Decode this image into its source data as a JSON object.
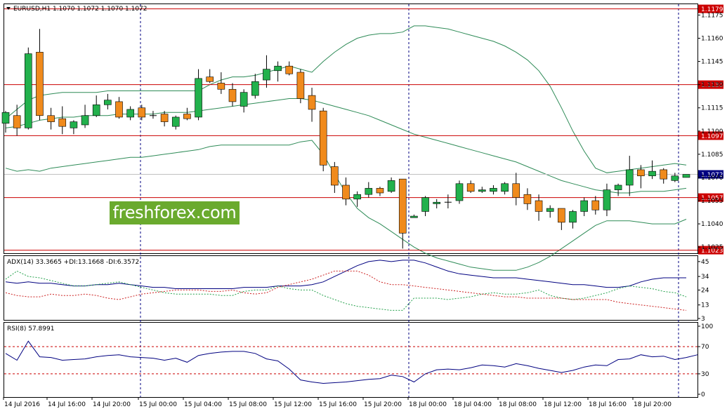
{
  "chart_data": {
    "type": "candlestick",
    "symbol_header": "EURUSD,H1  1.1070 1.1072 1.1070 1.1072",
    "x_labels": [
      "14 Jul 2016",
      "14 Jul 16:00",
      "14 Jul 20:00",
      "15 Jul 00:00",
      "15 Jul 04:00",
      "15 Jul 08:00",
      "15 Jul 12:00",
      "15 Jul 16:00",
      "15 Jul 20:00",
      "18 Jul 00:00",
      "18 Jul 04:00",
      "18 Jul 08:00",
      "18 Jul 12:00",
      "18 Jul 16:00",
      "18 Jul 20:00"
    ],
    "price_axis": {
      "ylim": [
        1.1021,
        1.1182
      ],
      "ticks": [
        "1.1175",
        "1.1160",
        "1.1145",
        "1.1130",
        "1.1115",
        "1.1100",
        "1.1085",
        "1.1070",
        "1.1055",
        "1.1040",
        "1.1025"
      ],
      "tick_values": [
        1.1175,
        1.116,
        1.1145,
        1.113,
        1.1115,
        1.11,
        1.1085,
        1.107,
        1.1055,
        1.104,
        1.1025
      ]
    },
    "candles": [
      {
        "o": 1.1105,
        "h": 1.1113,
        "l": 1.1099,
        "c": 1.1112
      },
      {
        "o": 1.111,
        "h": 1.1117,
        "l": 1.1097,
        "c": 1.1102
      },
      {
        "o": 1.1102,
        "h": 1.1154,
        "l": 1.1101,
        "c": 1.115
      },
      {
        "o": 1.1151,
        "h": 1.1166,
        "l": 1.1107,
        "c": 1.111
      },
      {
        "o": 1.111,
        "h": 1.1115,
        "l": 1.1101,
        "c": 1.1106
      },
      {
        "o": 1.1108,
        "h": 1.1116,
        "l": 1.1098,
        "c": 1.1103
      },
      {
        "o": 1.1102,
        "h": 1.1107,
        "l": 1.1098,
        "c": 1.1106
      },
      {
        "o": 1.1104,
        "h": 1.1117,
        "l": 1.1102,
        "c": 1.111
      },
      {
        "o": 1.111,
        "h": 1.1123,
        "l": 1.1109,
        "c": 1.1117
      },
      {
        "o": 1.1117,
        "h": 1.1124,
        "l": 1.1114,
        "c": 1.112
      },
      {
        "o": 1.1119,
        "h": 1.1122,
        "l": 1.1108,
        "c": 1.1109
      },
      {
        "o": 1.1109,
        "h": 1.1116,
        "l": 1.1107,
        "c": 1.1114
      },
      {
        "o": 1.1115,
        "h": 1.1117,
        "l": 1.1107,
        "c": 1.1109
      },
      {
        "o": 1.111,
        "h": 1.1113,
        "l": 1.1108,
        "c": 1.111
      },
      {
        "o": 1.1111,
        "h": 1.1113,
        "l": 1.1103,
        "c": 1.1106
      },
      {
        "o": 1.1103,
        "h": 1.111,
        "l": 1.1101,
        "c": 1.1109
      },
      {
        "o": 1.1111,
        "h": 1.1115,
        "l": 1.1107,
        "c": 1.1108
      },
      {
        "o": 1.1109,
        "h": 1.114,
        "l": 1.1107,
        "c": 1.1134
      },
      {
        "o": 1.1135,
        "h": 1.114,
        "l": 1.1131,
        "c": 1.1132
      },
      {
        "o": 1.1131,
        "h": 1.1138,
        "l": 1.1124,
        "c": 1.1127
      },
      {
        "o": 1.1127,
        "h": 1.1131,
        "l": 1.1116,
        "c": 1.1119
      },
      {
        "o": 1.1116,
        "h": 1.1127,
        "l": 1.1112,
        "c": 1.1125
      },
      {
        "o": 1.1123,
        "h": 1.1137,
        "l": 1.1121,
        "c": 1.1132
      },
      {
        "o": 1.1133,
        "h": 1.1149,
        "l": 1.1128,
        "c": 1.114
      },
      {
        "o": 1.1139,
        "h": 1.1145,
        "l": 1.1132,
        "c": 1.1142
      },
      {
        "o": 1.1142,
        "h": 1.1145,
        "l": 1.1136,
        "c": 1.1137
      },
      {
        "o": 1.1138,
        "h": 1.114,
        "l": 1.1118,
        "c": 1.1121
      },
      {
        "o": 1.1123,
        "h": 1.1128,
        "l": 1.1106,
        "c": 1.1114
      },
      {
        "o": 1.1113,
        "h": 1.1115,
        "l": 1.1074,
        "c": 1.1078
      },
      {
        "o": 1.1077,
        "h": 1.108,
        "l": 1.106,
        "c": 1.1065
      },
      {
        "o": 1.1065,
        "h": 1.107,
        "l": 1.1052,
        "c": 1.1056
      },
      {
        "o": 1.1056,
        "h": 1.1061,
        "l": 1.1051,
        "c": 1.1059
      },
      {
        "o": 1.1059,
        "h": 1.1067,
        "l": 1.1057,
        "c": 1.1063
      },
      {
        "o": 1.1063,
        "h": 1.1064,
        "l": 1.1058,
        "c": 1.106
      },
      {
        "o": 1.1061,
        "h": 1.107,
        "l": 1.106,
        "c": 1.1068
      },
      {
        "o": 1.1069,
        "h": 1.1069,
        "l": 1.1024,
        "c": 1.1034
      },
      {
        "o": 1.1044,
        "h": 1.1046,
        "l": 1.1044,
        "c": 1.1045
      },
      {
        "o": 1.1048,
        "h": 1.1058,
        "l": 1.1045,
        "c": 1.1057
      },
      {
        "o": 1.1053,
        "h": 1.1056,
        "l": 1.105,
        "c": 1.1054
      },
      {
        "o": 1.1054,
        "h": 1.1059,
        "l": 1.105,
        "c": 1.1054
      },
      {
        "o": 1.1055,
        "h": 1.1068,
        "l": 1.1053,
        "c": 1.1066
      },
      {
        "o": 1.1066,
        "h": 1.1068,
        "l": 1.106,
        "c": 1.1061
      },
      {
        "o": 1.1061,
        "h": 1.1064,
        "l": 1.106,
        "c": 1.1062
      },
      {
        "o": 1.1061,
        "h": 1.1065,
        "l": 1.1059,
        "c": 1.1063
      },
      {
        "o": 1.1061,
        "h": 1.1067,
        "l": 1.1059,
        "c": 1.1066
      },
      {
        "o": 1.1066,
        "h": 1.1073,
        "l": 1.1052,
        "c": 1.1057
      },
      {
        "o": 1.1059,
        "h": 1.1063,
        "l": 1.1049,
        "c": 1.1053
      },
      {
        "o": 1.1055,
        "h": 1.1059,
        "l": 1.1042,
        "c": 1.1048
      },
      {
        "o": 1.1048,
        "h": 1.1052,
        "l": 1.1044,
        "c": 1.105
      },
      {
        "o": 1.105,
        "h": 1.105,
        "l": 1.1036,
        "c": 1.1041
      },
      {
        "o": 1.1041,
        "h": 1.1049,
        "l": 1.1037,
        "c": 1.1048
      },
      {
        "o": 1.1048,
        "h": 1.1057,
        "l": 1.1045,
        "c": 1.1055
      },
      {
        "o": 1.1055,
        "h": 1.1058,
        "l": 1.1046,
        "c": 1.1049
      },
      {
        "o": 1.1049,
        "h": 1.1066,
        "l": 1.1045,
        "c": 1.1062
      },
      {
        "o": 1.1062,
        "h": 1.1066,
        "l": 1.1058,
        "c": 1.1065
      },
      {
        "o": 1.1065,
        "h": 1.1084,
        "l": 1.1058,
        "c": 1.1075
      },
      {
        "o": 1.1075,
        "h": 1.1078,
        "l": 1.1063,
        "c": 1.1071
      },
      {
        "o": 1.1071,
        "h": 1.1081,
        "l": 1.1069,
        "c": 1.1074
      },
      {
        "o": 1.1075,
        "h": 1.1076,
        "l": 1.1066,
        "c": 1.1069
      },
      {
        "o": 1.1068,
        "h": 1.1073,
        "l": 1.1067,
        "c": 1.1071
      },
      {
        "o": 1.107,
        "h": 1.1072,
        "l": 1.107,
        "c": 1.1072
      }
    ],
    "bollinger": {
      "upper": [
        1.1108,
        1.1114,
        1.112,
        1.1123,
        1.1124,
        1.1125,
        1.1125,
        1.1125,
        1.1125,
        1.1126,
        1.1126,
        1.1126,
        1.1126,
        1.1126,
        1.1126,
        1.1126,
        1.1126,
        1.1126,
        1.113,
        1.1133,
        1.1135,
        1.1135,
        1.1136,
        1.1138,
        1.114,
        1.1142,
        1.114,
        1.1138,
        1.1145,
        1.1151,
        1.1156,
        1.116,
        1.1162,
        1.1163,
        1.1163,
        1.1164,
        1.1168,
        1.1168,
        1.1167,
        1.1166,
        1.1164,
        1.1162,
        1.116,
        1.1158,
        1.1155,
        1.1151,
        1.1146,
        1.1139,
        1.1129,
        1.1115,
        1.11,
        1.1087,
        1.1076,
        1.1073,
        1.1074,
        1.1075,
        1.1076,
        1.1077,
        1.1078,
        1.1079,
        1.1078
      ],
      "middle": [
        1.1102,
        1.1103,
        1.1105,
        1.1107,
        1.1108,
        1.1109,
        1.1109,
        1.111,
        1.111,
        1.111,
        1.1111,
        1.1111,
        1.1111,
        1.1111,
        1.1112,
        1.1112,
        1.1112,
        1.1113,
        1.1114,
        1.1115,
        1.1116,
        1.1117,
        1.1118,
        1.1119,
        1.112,
        1.1121,
        1.1121,
        1.112,
        1.1118,
        1.1116,
        1.1114,
        1.1112,
        1.111,
        1.1107,
        1.1104,
        1.1101,
        1.1098,
        1.1096,
        1.1094,
        1.1092,
        1.109,
        1.1088,
        1.1086,
        1.1084,
        1.1082,
        1.108,
        1.1077,
        1.1074,
        1.1071,
        1.1068,
        1.1066,
        1.1064,
        1.1062,
        1.1061,
        1.106,
        1.106,
        1.1061,
        1.1061,
        1.1061,
        1.1062,
        1.1063
      ],
      "lower": [
        1.1076,
        1.1074,
        1.1075,
        1.1074,
        1.1076,
        1.1077,
        1.1078,
        1.1079,
        1.108,
        1.1081,
        1.1082,
        1.1083,
        1.1083,
        1.1084,
        1.1085,
        1.1086,
        1.1087,
        1.1088,
        1.109,
        1.1091,
        1.1091,
        1.1091,
        1.1091,
        1.1091,
        1.1091,
        1.1091,
        1.1093,
        1.1094,
        1.1085,
        1.1072,
        1.106,
        1.105,
        1.1044,
        1.104,
        1.1035,
        1.103,
        1.1025,
        1.1021,
        1.1018,
        1.1016,
        1.1014,
        1.1012,
        1.1011,
        1.101,
        1.101,
        1.101,
        1.1012,
        1.1015,
        1.1019,
        1.1024,
        1.1029,
        1.1034,
        1.1039,
        1.1042,
        1.1042,
        1.1042,
        1.1041,
        1.104,
        1.104,
        1.104,
        1.1043
      ]
    },
    "levels": [
      {
        "value": 1.1179,
        "label": "1.1179",
        "color": "#cc0000"
      },
      {
        "value": 1.113,
        "label": "1.1130",
        "color": "#cc0000"
      },
      {
        "value": 1.1097,
        "label": "1.1097",
        "color": "#cc0000"
      },
      {
        "value": 1.1057,
        "label": "1.1057",
        "color": "#cc0000"
      },
      {
        "value": 1.1023,
        "label": "1.1023",
        "color": "#cc0000"
      }
    ],
    "current_price": {
      "value": 1.1072,
      "label": "1.1072",
      "color": "#000080"
    },
    "adx": {
      "header": "ADX(14) 33.3665 +DI:13.1668 -DI:6.3572",
      "ylim": [
        3,
        47
      ],
      "ticks": [
        "45",
        "34",
        "24",
        "13",
        "3"
      ],
      "tick_values": [
        45,
        34,
        24,
        13,
        3
      ],
      "adx": [
        30,
        29,
        30,
        29,
        29,
        28,
        27,
        27,
        28,
        28,
        29,
        28,
        27,
        26,
        26,
        25,
        25,
        25,
        25,
        25,
        25,
        26,
        26,
        26,
        27,
        27,
        27,
        28,
        30,
        34,
        38,
        42,
        45,
        46,
        45,
        46,
        46,
        44,
        41,
        38,
        36,
        35,
        34,
        33,
        33,
        33,
        32,
        31,
        30,
        29,
        28,
        28,
        27,
        26,
        26,
        27,
        30,
        32,
        33,
        33,
        33
      ],
      "plus_di": [
        32,
        38,
        34,
        33,
        31,
        29,
        27,
        27,
        28,
        29,
        30,
        28,
        26,
        24,
        22,
        21,
        21,
        21,
        21,
        20,
        20,
        23,
        24,
        24,
        27,
        25,
        24,
        24,
        20,
        17,
        14,
        12,
        11,
        10,
        9,
        9,
        18,
        18,
        18,
        17,
        18,
        19,
        21,
        22,
        21,
        21,
        22,
        24,
        20,
        18,
        17,
        18,
        20,
        22,
        25,
        27,
        26,
        25,
        23,
        22,
        19
      ],
      "minus_di": [
        22,
        20,
        19,
        19,
        21,
        20,
        20,
        21,
        20,
        18,
        17,
        19,
        21,
        22,
        23,
        24,
        24,
        24,
        23,
        23,
        24,
        22,
        21,
        22,
        26,
        28,
        30,
        32,
        35,
        38,
        38,
        38,
        35,
        30,
        28,
        28,
        27,
        26,
        25,
        24,
        23,
        22,
        21,
        20,
        19,
        19,
        18,
        18,
        18,
        18,
        17,
        17,
        17,
        17,
        15,
        14,
        13,
        12,
        11,
        10,
        9
      ]
    },
    "rsi": {
      "header": "RSI(8) 57.8991",
      "ylim": [
        0,
        100
      ],
      "ticks": [
        "100",
        "70",
        "30",
        "0"
      ],
      "tick_values": [
        100,
        70,
        30,
        0
      ],
      "levels": [
        70,
        30
      ],
      "values": [
        60,
        50,
        78,
        55,
        54,
        50,
        51,
        52,
        55,
        57,
        58,
        55,
        54,
        53,
        50,
        53,
        47,
        57,
        60,
        62,
        63,
        63,
        60,
        52,
        49,
        37,
        21,
        18,
        16,
        17,
        18,
        20,
        22,
        23,
        28,
        26,
        18,
        30,
        36,
        37,
        36,
        39,
        43,
        42,
        40,
        45,
        42,
        38,
        35,
        32,
        35,
        40,
        43,
        42,
        51,
        52,
        58,
        55,
        56,
        51,
        54,
        58
      ]
    }
  },
  "branding": {
    "logo_text": "freshforex.com"
  }
}
